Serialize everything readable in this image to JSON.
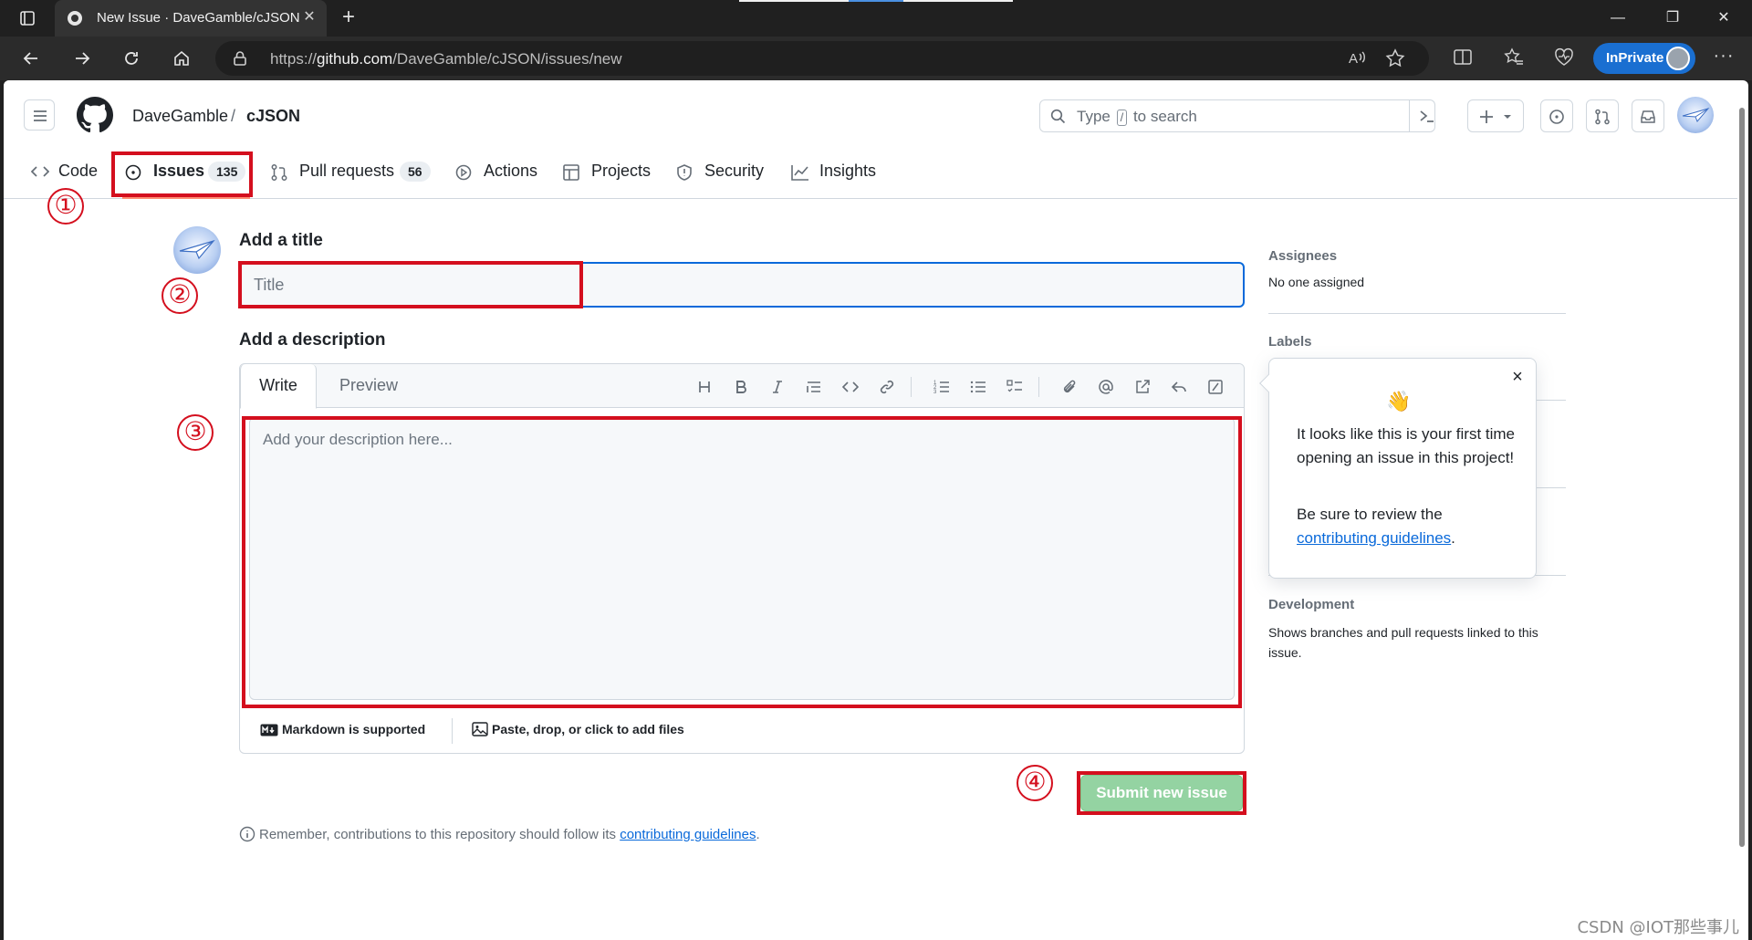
{
  "browser": {
    "tab_title": "New Issue · DaveGamble/cJSON",
    "url_prefix": "https://",
    "url_host": "github.com",
    "url_path": "/DaveGamble/cJSON/issues/new",
    "inprivate_label": "InPrivate"
  },
  "repo": {
    "owner": "DaveGamble",
    "separator": "/",
    "name": "cJSON"
  },
  "search": {
    "prefix": "Type",
    "key": "/",
    "suffix": "to search"
  },
  "nav": {
    "code": "Code",
    "issues": "Issues",
    "issues_count": "135",
    "pulls": "Pull requests",
    "pulls_count": "56",
    "actions": "Actions",
    "projects": "Projects",
    "security": "Security",
    "insights": "Insights"
  },
  "form": {
    "title_heading": "Add a title",
    "title_placeholder": "Title",
    "desc_heading": "Add a description",
    "tab_write": "Write",
    "tab_preview": "Preview",
    "desc_placeholder": "Add your description here...",
    "markdown_note": "Markdown is supported",
    "attach_note": "Paste, drop, or click to add files",
    "submit_label": "Submit new issue",
    "footer_note": "Remember, contributions to this repository should follow its",
    "footer_link": "contributing guidelines",
    "footer_end": "."
  },
  "sidebar": {
    "assignees_heading": "Assignees",
    "assignees_value": "No one assigned",
    "labels_heading": "Labels",
    "development_heading": "Development",
    "development_text": "Shows branches and pull requests linked to this issue."
  },
  "popover": {
    "emoji": "👋",
    "text1": "It looks like this is your first time opening an issue in this project!",
    "text2_prefix": "Be sure to review the",
    "text2_link": "contributing guidelines",
    "text2_suffix": "."
  },
  "annotations": {
    "n1": "①",
    "n2": "②",
    "n3": "③",
    "n4": "④",
    "color": "#d40f1e"
  },
  "watermark": "CSDN @IOT那些事儿",
  "colors": {
    "accent": "#0969da",
    "submit_disabled": "#94d3a2",
    "tab_underline": "#fd8c73"
  }
}
